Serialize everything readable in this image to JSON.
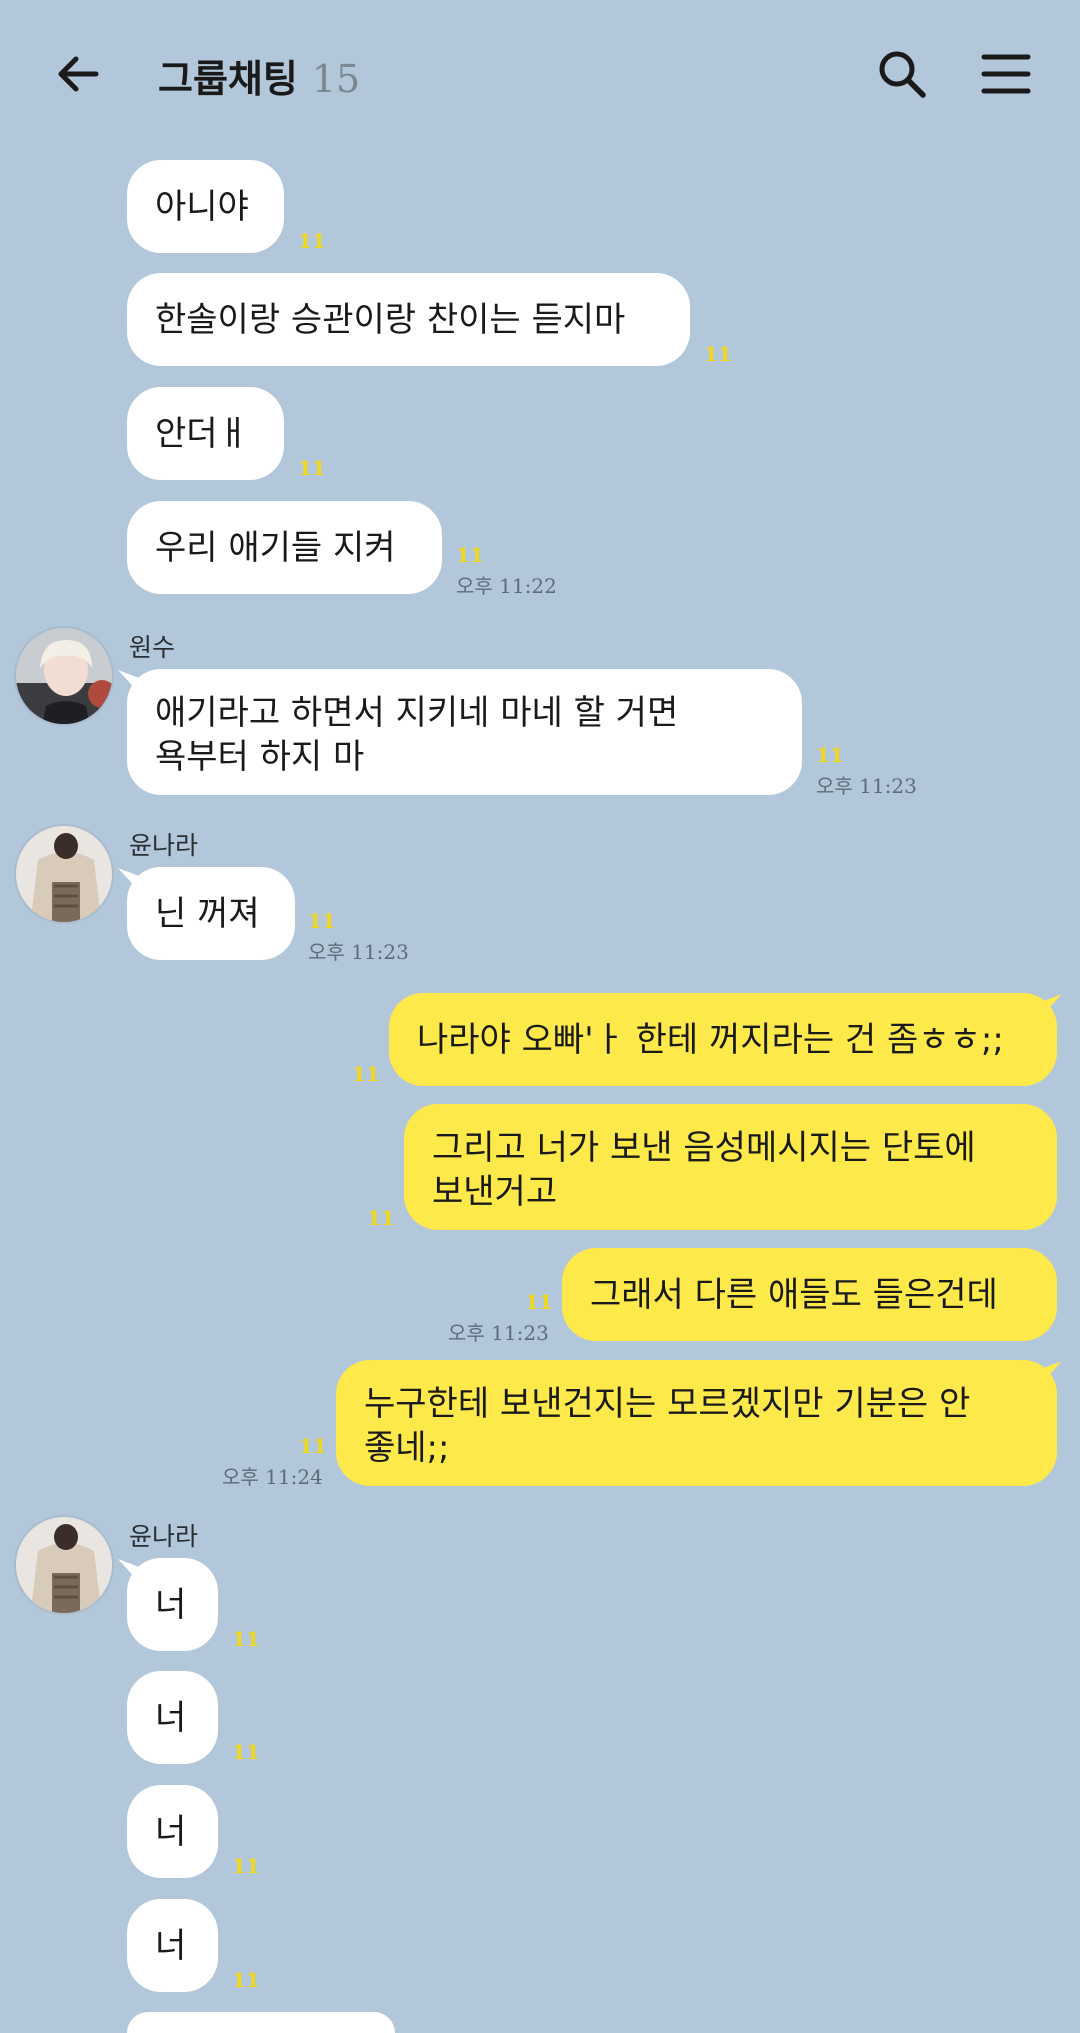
{
  "header": {
    "title": "그룹채팅",
    "member_count": "15"
  },
  "icons": {
    "back": "arrow-left-icon",
    "search": "search-icon",
    "menu": "hamburger-menu-icon"
  },
  "colors": {
    "background": "#b2c7d9",
    "incoming_bubble": "#ffffff",
    "outgoing_bubble": "#fee94a",
    "unread_count": "#f2d81b"
  },
  "messages": {
    "m1": {
      "text": "아니야",
      "unread": "11"
    },
    "m2": {
      "text": "한솔이랑 승관이랑 찬이는 듣지마",
      "unread": "11"
    },
    "m3": {
      "text": "안더ㅐ",
      "unread": "11"
    },
    "m4": {
      "text": "우리 애기들 지켜",
      "unread": "11",
      "time": "오후 11:22"
    },
    "m5": {
      "sender": "원수",
      "line1": "애기라고 하면서 지키네 마네 할 거면",
      "line2": "욕부터 하지 마",
      "unread": "11",
      "time": "오후 11:23"
    },
    "m6": {
      "sender": "윤나라",
      "text": "닌 꺼져",
      "unread": "11",
      "time": "오후 11:23"
    },
    "m7": {
      "text": "나라야 오빠'ㅏ 한테 꺼지라는 건 좀ㅎㅎ;;",
      "unread": "11"
    },
    "m8": {
      "line1": "그리고 너가 보낸 음성메시지는 단토에",
      "line2": "보낸거고",
      "unread": "11"
    },
    "m9": {
      "text": "그래서 다른 애들도 들은건데",
      "unread": "11",
      "time": "오후 11:23"
    },
    "m10": {
      "line1": "누구한테 보낸건지는 모르겠지만 기분은 안",
      "line2": "좋네;;",
      "unread": "11",
      "time": "오후 11:24"
    },
    "m11": {
      "sender": "윤나라",
      "text": "너",
      "unread": "11"
    },
    "m12": {
      "text": "너",
      "unread": "11"
    },
    "m13": {
      "text": "너",
      "unread": "11"
    },
    "m14": {
      "text": "너",
      "unread": "11"
    }
  }
}
